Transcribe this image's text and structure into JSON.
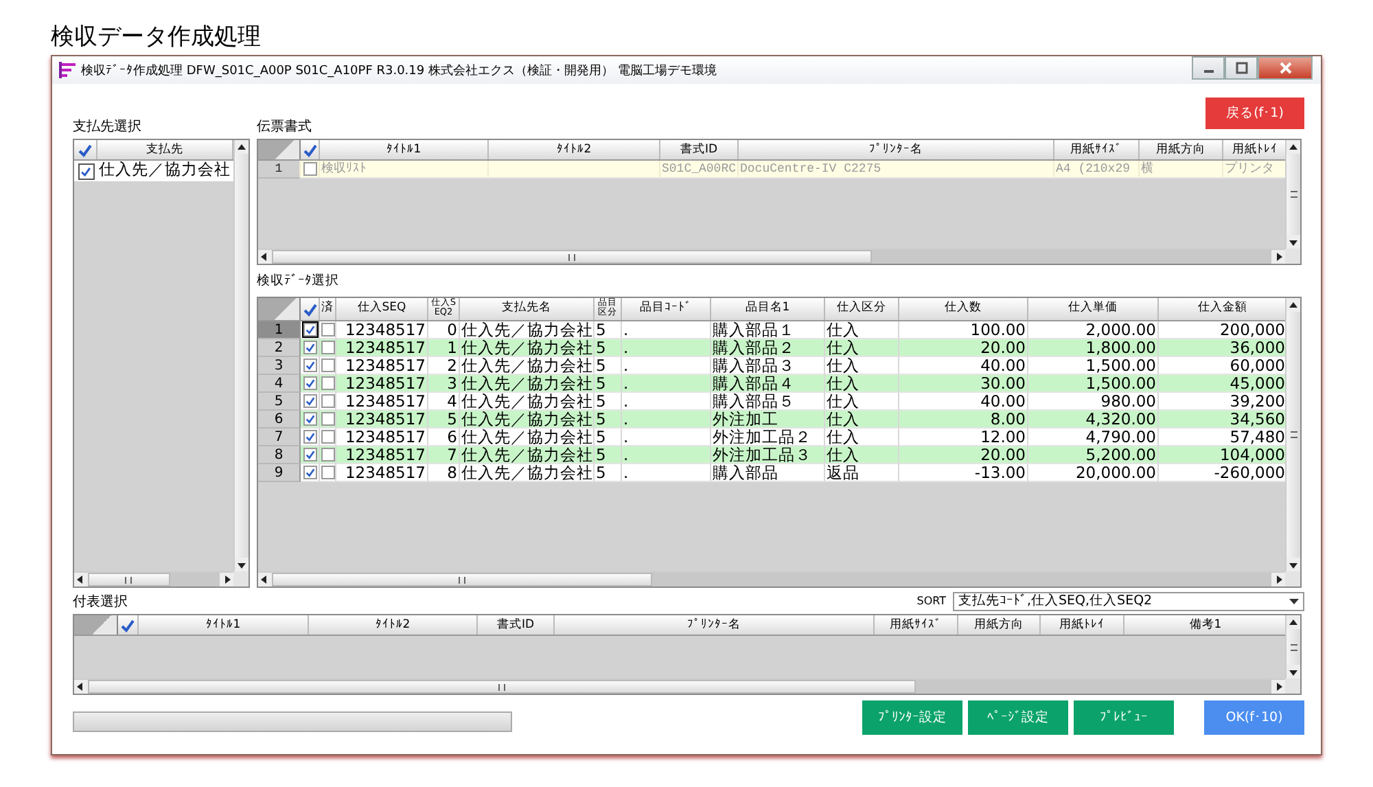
{
  "page_title": "検収データ作成処理",
  "window": {
    "title": "検収ﾃﾞｰﾀ作成処理 DFW_S01C_A00P S01C_A10PF R3.0.19 株式会社エクス（検証・開発用） 電脳工場デモ環境"
  },
  "back_button": "戻る(f･1)",
  "payee_panel": {
    "label": "支払先選択",
    "column": "支払先",
    "items": [
      {
        "label": "仕入先／協力会社",
        "checked": true
      }
    ]
  },
  "form_panel": {
    "label": "伝票書式",
    "columns": [
      "ﾀｲﾄﾙ1",
      "ﾀｲﾄﾙ2",
      "書式ID",
      "ﾌﾟﾘﾝﾀｰ名",
      "用紙ｻｲｽﾞ",
      "用紙方向",
      "用紙ﾄﾚｲ"
    ],
    "rows": [
      {
        "number": "1",
        "checked": false,
        "cells": [
          "検収ﾘｽﾄ",
          null,
          "S01C_A00RC",
          "DocuCentre-IV C2275",
          "A4 (210x29",
          "横",
          "プリンタ"
        ]
      }
    ]
  },
  "inspection_panel": {
    "label": "検収ﾃﾞｰﾀ選択",
    "done_column": "済",
    "columns": [
      "仕入SEQ",
      "仕入SEQ2",
      "支払先名",
      "品目区分",
      "品目ｺｰﾄﾞ",
      "品目名1",
      "仕入区分",
      "仕入数",
      "仕入単価",
      "仕入金額"
    ],
    "rows": [
      {
        "number": "1",
        "selected": true,
        "checked": true,
        "done": false,
        "cells": [
          "12348517",
          "0",
          "仕入先／協力会社",
          "5",
          ".",
          "購入部品１",
          "仕入",
          "100.00",
          "2,000.00",
          "200,000"
        ]
      },
      {
        "number": "2",
        "selected": false,
        "checked": true,
        "done": false,
        "cells": [
          "12348517",
          "1",
          "仕入先／協力会社",
          "5",
          ".",
          "購入部品２",
          "仕入",
          "20.00",
          "1,800.00",
          "36,000"
        ]
      },
      {
        "number": "3",
        "selected": false,
        "checked": true,
        "done": false,
        "cells": [
          "12348517",
          "2",
          "仕入先／協力会社",
          "5",
          ".",
          "購入部品３",
          "仕入",
          "40.00",
          "1,500.00",
          "60,000"
        ]
      },
      {
        "number": "4",
        "selected": false,
        "checked": true,
        "done": false,
        "cells": [
          "12348517",
          "3",
          "仕入先／協力会社",
          "5",
          ".",
          "購入部品４",
          "仕入",
          "30.00",
          "1,500.00",
          "45,000"
        ]
      },
      {
        "number": "5",
        "selected": false,
        "checked": true,
        "done": false,
        "cells": [
          "12348517",
          "4",
          "仕入先／協力会社",
          "5",
          ".",
          "購入部品５",
          "仕入",
          "40.00",
          "980.00",
          "39,200"
        ]
      },
      {
        "number": "6",
        "selected": false,
        "checked": true,
        "done": false,
        "cells": [
          "12348517",
          "5",
          "仕入先／協力会社",
          "5",
          ".",
          "外注加工",
          "仕入",
          "8.00",
          "4,320.00",
          "34,560"
        ]
      },
      {
        "number": "7",
        "selected": false,
        "checked": true,
        "done": false,
        "cells": [
          "12348517",
          "6",
          "仕入先／協力会社",
          "5",
          ".",
          "外注加工品２",
          "仕入",
          "12.00",
          "4,790.00",
          "57,480"
        ]
      },
      {
        "number": "8",
        "selected": false,
        "checked": true,
        "done": false,
        "cells": [
          "12348517",
          "7",
          "仕入先／協力会社",
          "5",
          ".",
          "外注加工品３",
          "仕入",
          "20.00",
          "5,200.00",
          "104,000"
        ]
      },
      {
        "number": "9",
        "selected": false,
        "checked": true,
        "done": false,
        "cells": [
          "12348517",
          "8",
          "仕入先／協力会社",
          "5",
          ".",
          "購入部品",
          "返品",
          "-13.00",
          "20,000.00",
          "-260,000"
        ]
      }
    ]
  },
  "attachment_panel": {
    "label": "付表選択",
    "columns": [
      "ﾀｲﾄﾙ1",
      "ﾀｲﾄﾙ2",
      "書式ID",
      "ﾌﾟﾘﾝﾀｰ名",
      "用紙ｻｲｽﾞ",
      "用紙方向",
      "用紙ﾄﾚｲ",
      "備考1"
    ]
  },
  "sort": {
    "label": "SORT",
    "value": "支払先ｺｰﾄﾞ,仕入SEQ,仕入SEQ2"
  },
  "progress": {
    "level": 0
  },
  "buttons": [
    {
      "label": "ﾌﾟﾘﾝﾀｰ設定",
      "kind": "action"
    },
    {
      "label": "ﾍﾟｰｼﾞ設定",
      "kind": "action"
    },
    {
      "label": "ﾌﾟﾚﾋﾞｭｰ",
      "kind": "action"
    },
    {
      "label": "OK(f･10)",
      "kind": "confirm"
    }
  ]
}
